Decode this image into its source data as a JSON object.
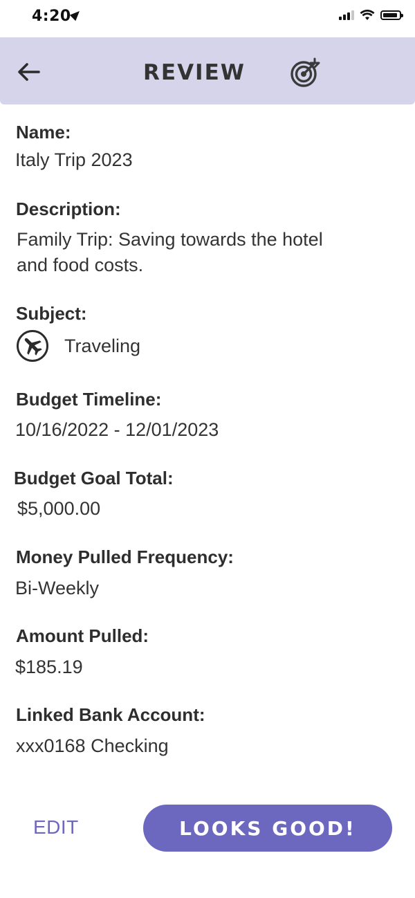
{
  "status_bar": {
    "time": "4:20"
  },
  "header": {
    "title": "REVIEW"
  },
  "fields": {
    "name": {
      "label": "Name:",
      "value": "Italy Trip 2023"
    },
    "description": {
      "label": "Description:",
      "value_line1": "Family Trip: Saving towards the hotel",
      "value_line2": "and food costs."
    },
    "subject": {
      "label": "Subject:",
      "value": "Traveling",
      "icon": "airplane-icon"
    },
    "budget_timeline": {
      "label": "Budget Timeline:",
      "value": "10/16/2022 - 12/01/2023"
    },
    "budget_goal_total": {
      "label": "Budget Goal Total:",
      "value": "$5,000.00"
    },
    "frequency": {
      "label": "Money Pulled Frequency:",
      "value": "Bi-Weekly"
    },
    "amount_pulled": {
      "label": "Amount Pulled:",
      "value": "$185.19"
    },
    "linked_account": {
      "label": "Linked Bank Account:",
      "value": "xxx0168 Checking"
    }
  },
  "actions": {
    "edit_label": "EDIT",
    "confirm_label": "LOOKS GOOD!"
  },
  "colors": {
    "header_bg": "#d6d4eb",
    "accent": "#6d68bf"
  }
}
